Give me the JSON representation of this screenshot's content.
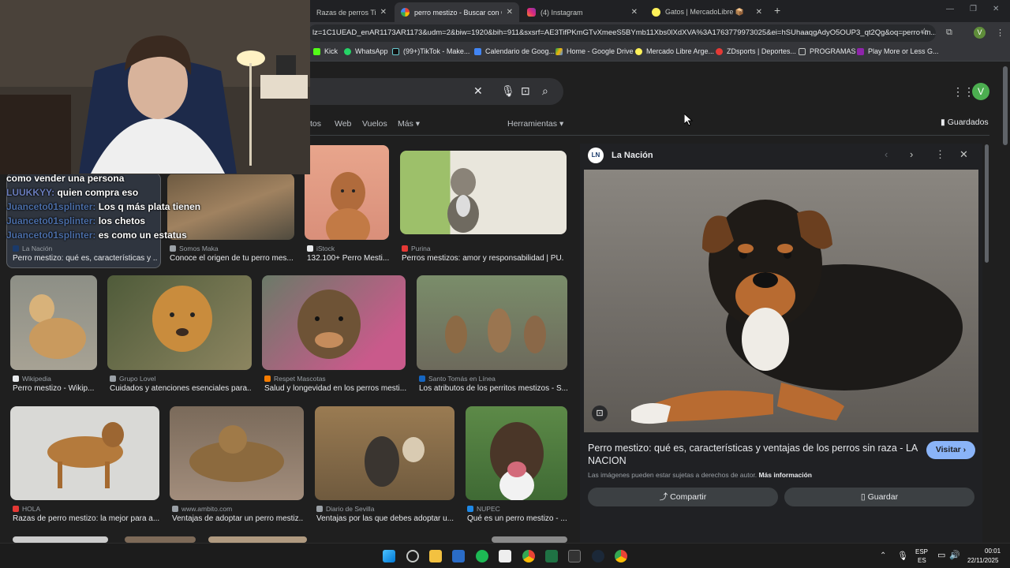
{
  "tabs": [
    {
      "title": "Razas de perros Tier L",
      "active": false
    },
    {
      "title": "perro mestizo - Buscar con Goo",
      "active": true
    },
    {
      "title": "(4) Instagram",
      "active": false
    },
    {
      "title": "Gatos | MercadoLibre 📦",
      "active": false
    }
  ],
  "omnibox": {
    "url": "lz=1C1UEAD_enAR1173AR1173&udm=2&biw=1920&bih=911&sxsrf=AE3TifPKmGTvXmeeS5BYmb11Xbs0lXdXVA%3A1763779973025&ei=hSUhaaqgAdyO5OUP3_qt2Qg&oq=perro+m..."
  },
  "toolbar": {
    "profile_initial": "V"
  },
  "bookmarks": [
    "Kick",
    "WhatsApp",
    "(99+)TikTok - Make...",
    "Calendario de Goog...",
    "Home - Google Drive",
    "Mercado Libre Arge...",
    "ZDsports | Deportes...",
    "PROGRAMAS",
    "Play More or Less G..."
  ],
  "google": {
    "filters": [
      "tos",
      "Web",
      "Vuelos",
      "Más ▾"
    ],
    "herramientas": "Herramientas ▾",
    "guardados": "Guardados",
    "profile_initial": "V"
  },
  "grid": {
    "row1": [
      {
        "source": "La Nación",
        "title": "Perro mestizo: qué es, características y ..."
      },
      {
        "source": "Somos Maka",
        "title": "Conoce el origen de tu perro mes..."
      },
      {
        "source": "iStock",
        "title": "132.100+ Perro Mesti..."
      },
      {
        "source": "Purina",
        "title": "Perros mestizos: amor y responsabilidad | PU..."
      }
    ],
    "row2": [
      {
        "source": "Wikipedia",
        "title": "Perro mestizo - Wikip..."
      },
      {
        "source": "Grupo Lovel",
        "title": "Cuidados y atenciones esenciales para..."
      },
      {
        "source": "Respet Mascotas",
        "title": "Salud y longevidad en los perros mesti..."
      },
      {
        "source": "Santo Tomás en Línea",
        "title": "Los atributos de los perritos mestizos - S..."
      }
    ],
    "row3": [
      {
        "source": "HOLA",
        "title": "Razas de perro mestizo: la mejor para a..."
      },
      {
        "source": "www.ambito.com",
        "title": "Ventajas de adoptar un perro mestiz..."
      },
      {
        "source": "Diario de Sevilla",
        "title": "Ventajas por las que debes adoptar u..."
      },
      {
        "source": "NUPEC",
        "title": "Qué es un perro mestizo - ..."
      }
    ]
  },
  "panel": {
    "logo": "LN",
    "source": "La Nación",
    "title": "Perro mestizo: qué es, características y ventajas de los perros sin raza - LA NACION",
    "visit": "Visitar ›",
    "rights": "Las imágenes pueden estar sujetas a derechos de autor.",
    "more_info": "Más información",
    "share": "Compartir",
    "save": "Guardar"
  },
  "chat": [
    {
      "user": "",
      "message": "como vender una persona"
    },
    {
      "user": "LUUKKYY:",
      "message": "quien compra eso"
    },
    {
      "user": "Juanceto01splinter:",
      "message": "Los q más plata tienen"
    },
    {
      "user": "Juanceto01splinter:",
      "message": "los chetos"
    },
    {
      "user": "Juanceto01splinter:",
      "message": "es como un estatus"
    }
  ],
  "taskbar": {
    "lang_top": "ESP",
    "lang_bottom": "ES",
    "time": "00:01",
    "date": "22/11/2025"
  }
}
